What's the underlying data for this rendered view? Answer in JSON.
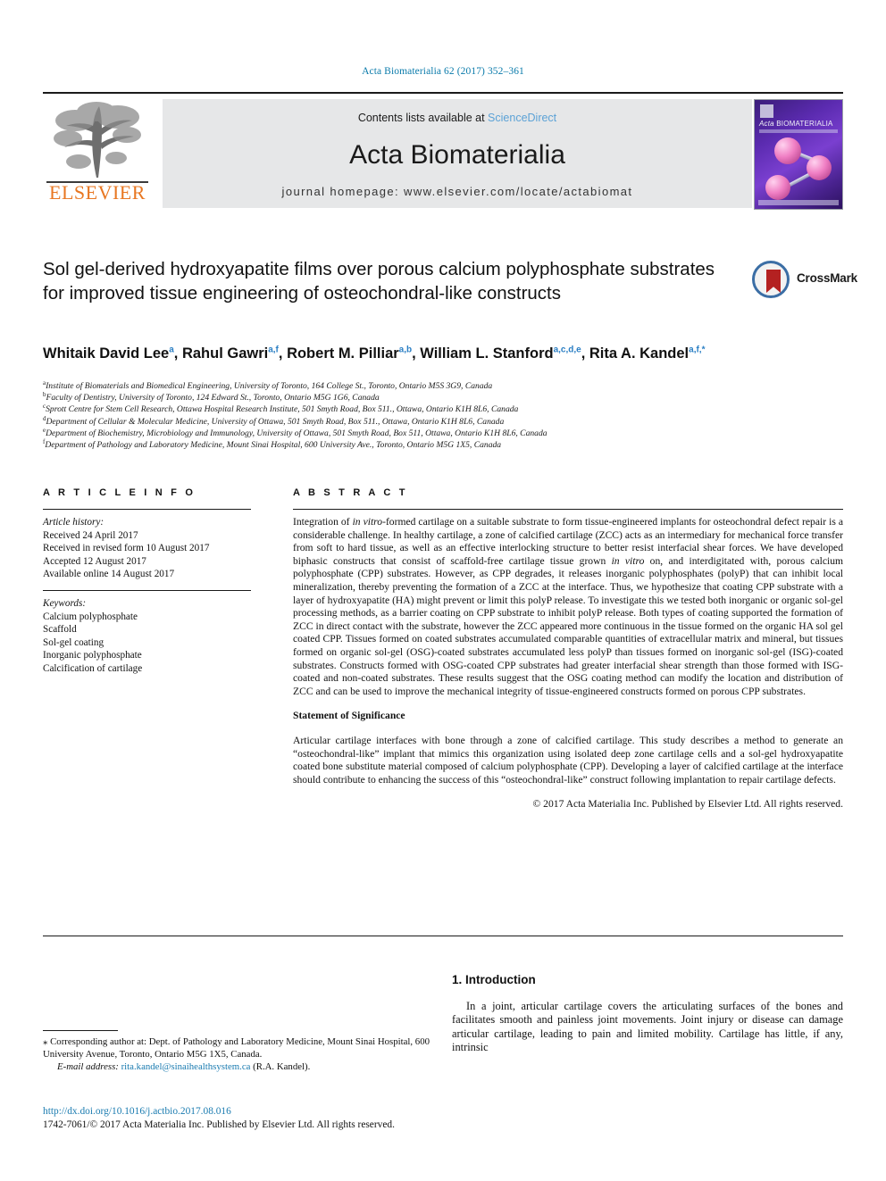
{
  "running_head": "Acta Biomaterialia 62 (2017) 352–361",
  "masthead": {
    "contents_prefix": "Contents lists available at ",
    "sciencedirect": "ScienceDirect",
    "journal_title": "Acta Biomaterialia",
    "homepage": "journal homepage: www.elsevier.com/locate/actabiomat",
    "publisher_logo_text": "ELSEVIER",
    "cover_title_italic": "Acta",
    "cover_title_rest": " BIOMATERIALIA",
    "accent_link_color": "#5ca2d6",
    "elsevier_orange": "#e87722"
  },
  "article": {
    "title": "Sol gel-derived hydroxyapatite films over porous calcium polyphosphate substrates for improved tissue engineering of osteochondral-like constructs",
    "crossmark_label": "CrossMark",
    "authors": [
      {
        "name": "Whitaik David Lee",
        "sup": "a"
      },
      {
        "name": "Rahul Gawri",
        "sup": "a,f"
      },
      {
        "name": "Robert M. Pilliar",
        "sup": "a,b"
      },
      {
        "name": "William L. Stanford",
        "sup": "a,c,d,e"
      },
      {
        "name": "Rita A. Kandel",
        "sup": "a,f,*"
      }
    ],
    "affiliations": [
      {
        "mark": "a",
        "text": "Institute of Biomaterials and Biomedical Engineering, University of Toronto, 164 College St., Toronto, Ontario M5S 3G9, Canada"
      },
      {
        "mark": "b",
        "text": "Faculty of Dentistry, University of Toronto, 124 Edward St., Toronto, Ontario M5G 1G6, Canada"
      },
      {
        "mark": "c",
        "text": "Sprott Centre for Stem Cell Research, Ottawa Hospital Research Institute, 501 Smyth Road, Box 511., Ottawa, Ontario K1H 8L6, Canada"
      },
      {
        "mark": "d",
        "text": "Department of Cellular & Molecular Medicine, University of Ottawa, 501 Smyth Road, Box 511., Ottawa, Ontario K1H 8L6, Canada"
      },
      {
        "mark": "e",
        "text": "Department of Biochemistry, Microbiology and Immunology, University of Ottawa, 501 Smyth Road, Box 511, Ottawa, Ontario K1H 8L6, Canada"
      },
      {
        "mark": "f",
        "text": "Department of Pathology and Laboratory Medicine, Mount Sinai Hospital, 600 University Ave., Toronto, Ontario M5G 1X5, Canada"
      }
    ]
  },
  "article_info": {
    "heading": "A R T I C L E   I N F O",
    "history_label": "Article history:",
    "history": [
      "Received 24 April 2017",
      "Received in revised form 10 August 2017",
      "Accepted 12 August 2017",
      "Available online 14 August 2017"
    ],
    "keywords_label": "Keywords:",
    "keywords": [
      "Calcium polyphosphate",
      "Scaffold",
      "Sol-gel coating",
      "Inorganic polyphosphate",
      "Calcification of cartilage"
    ]
  },
  "abstract": {
    "heading": "A B S T R A C T",
    "paragraph": "Integration of in vitro-formed cartilage on a suitable substrate to form tissue-engineered implants for osteochondral defect repair is a considerable challenge. In healthy cartilage, a zone of calcified cartilage (ZCC) acts as an intermediary for mechanical force transfer from soft to hard tissue, as well as an effective interlocking structure to better resist interfacial shear forces. We have developed biphasic constructs that consist of scaffold-free cartilage tissue grown in vitro on, and interdigitated with, porous calcium polyphosphate (CPP) substrates. However, as CPP degrades, it releases inorganic polyphosphates (polyP) that can inhibit local mineralization, thereby preventing the formation of a ZCC at the interface. Thus, we hypothesize that coating CPP substrate with a layer of hydroxyapatite (HA) might prevent or limit this polyP release. To investigate this we tested both inorganic or organic sol-gel processing methods, as a barrier coating on CPP substrate to inhibit polyP release. Both types of coating supported the formation of ZCC in direct contact with the substrate, however the ZCC appeared more continuous in the tissue formed on the organic HA sol gel coated CPP. Tissues formed on coated substrates accumulated comparable quantities of extracellular matrix and mineral, but tissues formed on organic sol-gel (OSG)-coated substrates accumulated less polyP than tissues formed on inorganic sol-gel (ISG)-coated substrates. Constructs formed with OSG-coated CPP substrates had greater interfacial shear strength than those formed with ISG-coated and non-coated substrates. These results suggest that the OSG coating method can modify the location and distribution of ZCC and can be used to improve the mechanical integrity of tissue-engineered constructs formed on porous CPP substrates.",
    "statement_heading": "Statement of Significance",
    "statement": "Articular cartilage interfaces with bone through a zone of calcified cartilage. This study describes a method to generate an “osteochondral-like” implant that mimics this organization using isolated deep zone cartilage cells and a sol-gel hydroxyapatite coated bone substitute material composed of calcium polyphosphate (CPP). Developing a layer of calcified cartilage at the interface should contribute to enhancing the success of this “osteochondral-like” construct following implantation to repair cartilage defects.",
    "copyright": "© 2017 Acta Materialia Inc. Published by Elsevier Ltd. All rights reserved."
  },
  "introduction": {
    "heading": "1. Introduction",
    "paragraph": "In a joint, articular cartilage covers the articulating surfaces of the bones and facilitates smooth and painless joint movements. Joint injury or disease can damage articular cartilage, leading to pain and limited mobility. Cartilage has little, if any, intrinsic"
  },
  "footnote": {
    "corresponding": "⁎ Corresponding author at: Dept. of Pathology and Laboratory Medicine, Mount Sinai Hospital, 600 University Avenue, Toronto, Ontario M5G 1X5, Canada.",
    "email_label": "E-mail address:",
    "email": "rita.kandel@sinaihealthsystem.ca",
    "email_owner": "(R.A. Kandel)."
  },
  "footer": {
    "doi": "http://dx.doi.org/10.1016/j.actbio.2017.08.016",
    "issn_line": "1742-7061/© 2017 Acta Materialia Inc. Published by Elsevier Ltd. All rights reserved."
  }
}
